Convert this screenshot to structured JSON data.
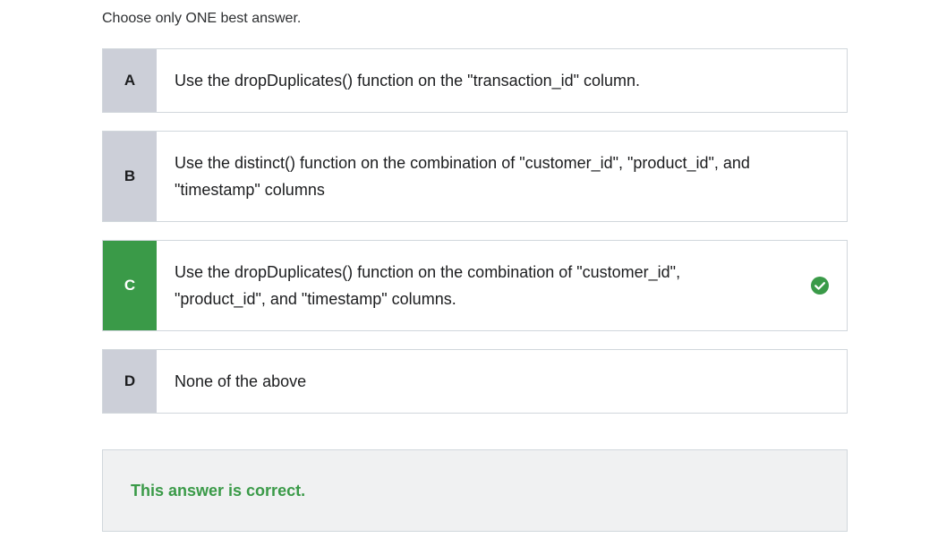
{
  "instruction": "Choose only ONE best answer.",
  "options": [
    {
      "letter": "A",
      "text": "Use the dropDuplicates() function on the \"transaction_id\" column."
    },
    {
      "letter": "B",
      "text": "Use the distinct() function on the combination of \"customer_id\", \"product_id\", and \"timestamp\" columns"
    },
    {
      "letter": "C",
      "text": "Use the dropDuplicates() function on the combination of \"customer_id\", \"product_id\", and \"timestamp\" columns.",
      "correct_icon": "check-circle-icon"
    },
    {
      "letter": "D",
      "text": "None of the above"
    }
  ],
  "feedback": {
    "message": "This answer is correct."
  },
  "colors": {
    "correct": "#3a9a48",
    "letter_bg": "#cccfd8",
    "feedback_bg": "#f0f1f2",
    "border": "#d1d7dc"
  }
}
